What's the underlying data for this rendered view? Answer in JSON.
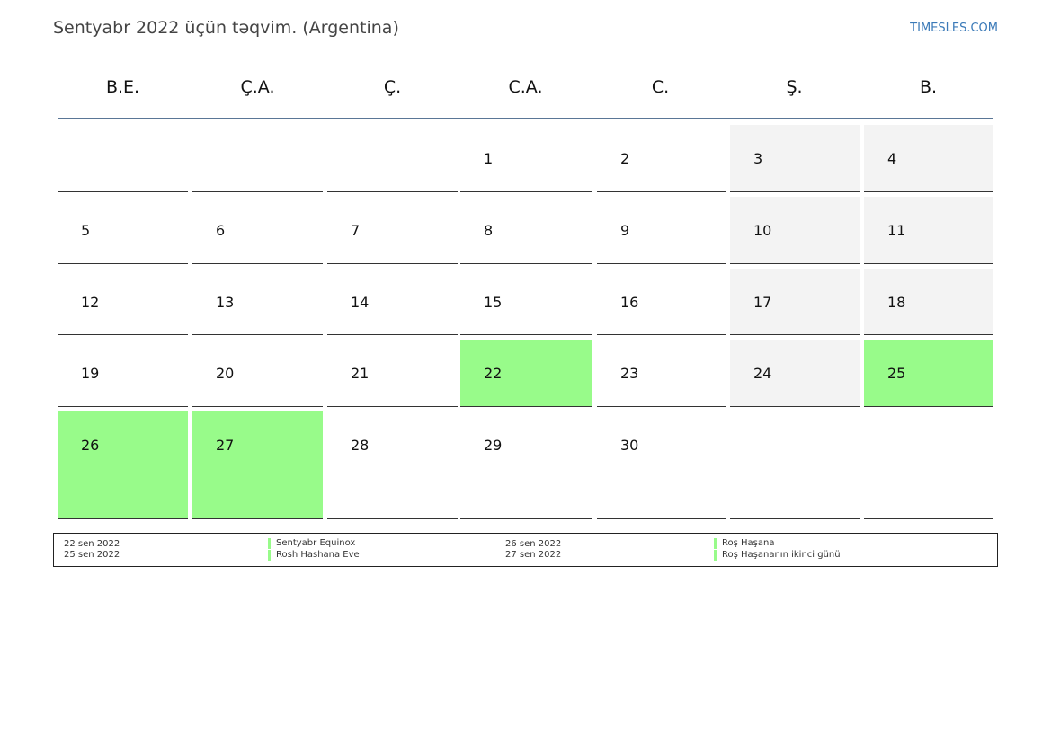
{
  "header": {
    "title": "Sentyabr 2022 üçün təqvim. (Argentina)",
    "site": "TIMESLES.COM"
  },
  "weekdays": [
    "B.E.",
    "Ç.A.",
    "Ç.",
    "C.A.",
    "C.",
    "Ş.",
    "B."
  ],
  "weeks": [
    [
      "",
      "",
      "",
      "1",
      "2",
      "3",
      "4"
    ],
    [
      "5",
      "6",
      "7",
      "8",
      "9",
      "10",
      "11"
    ],
    [
      "12",
      "13",
      "14",
      "15",
      "16",
      "17",
      "18"
    ],
    [
      "19",
      "20",
      "21",
      "22",
      "23",
      "24",
      "25"
    ],
    [
      "26",
      "27",
      "28",
      "29",
      "30",
      "",
      ""
    ]
  ],
  "holidays": [
    "22",
    "25",
    "26",
    "27"
  ],
  "colors": {
    "holiday": "#98fb8a",
    "weekend": "#f3f3f3",
    "header_line": "#5a7696"
  },
  "legend": [
    {
      "date": "22 sen 2022",
      "name": "Sentyabr Equinox"
    },
    {
      "date": "25 sen 2022",
      "name": "Rosh Hashana Eve"
    },
    {
      "date": "26 sen 2022",
      "name": "Roş Haşana"
    },
    {
      "date": "27 sen 2022",
      "name": "Roş Haşananın ikinci günü"
    }
  ]
}
